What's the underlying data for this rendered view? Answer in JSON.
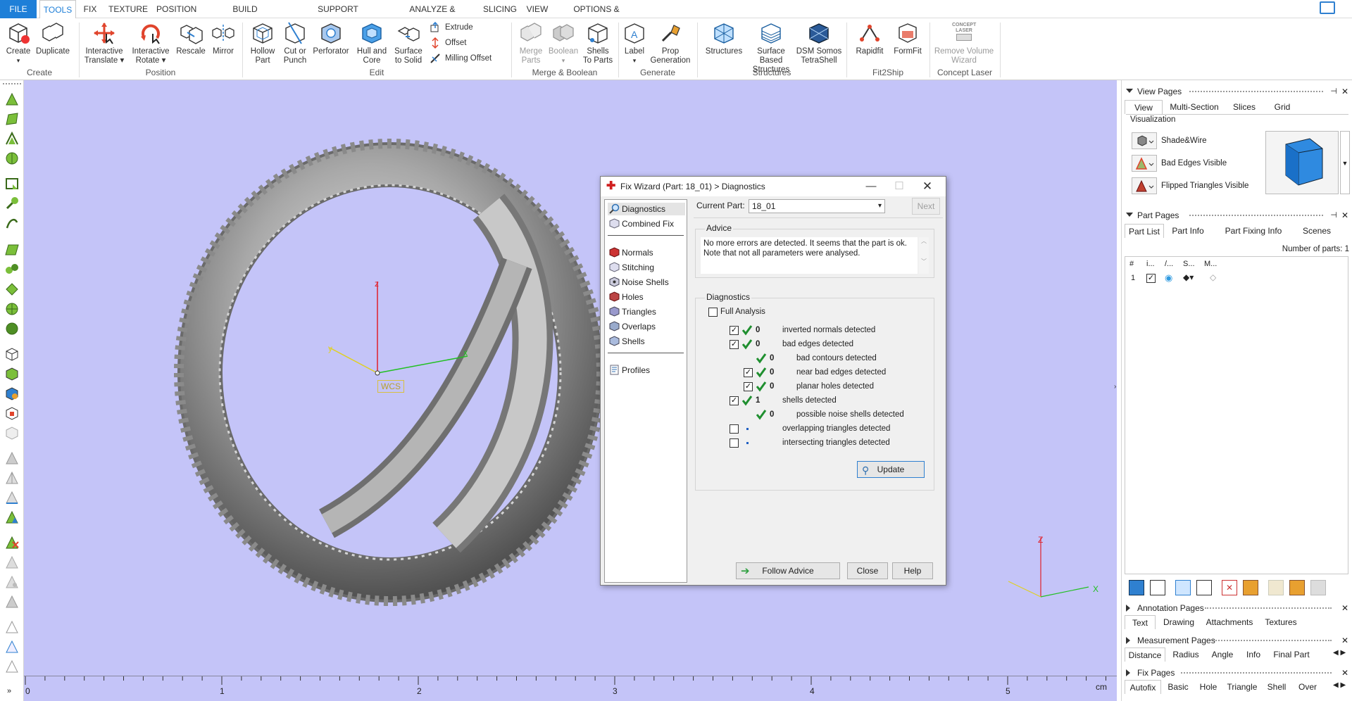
{
  "menu": {
    "tabs": [
      "FILE",
      "TOOLS",
      "FIX",
      "TEXTURE",
      "POSITION",
      "BUILD PREPARATION",
      "SUPPORT GENERATION",
      "ANALYZE & REPORT",
      "SLICING",
      "VIEW",
      "OPTIONS & HELP"
    ],
    "active": "TOOLS"
  },
  "ribbon": {
    "create": {
      "create": "Create",
      "duplicate": "Duplicate",
      "group": "Create"
    },
    "position": {
      "translate1": "Interactive",
      "translate2": "Translate",
      "rotate1": "Interactive",
      "rotate2": "Rotate",
      "rescale": "Rescale",
      "mirror": "Mirror",
      "group": "Position"
    },
    "edit": {
      "hollow1": "Hollow",
      "hollow2": "Part",
      "cut1": "Cut or",
      "cut2": "Punch",
      "perforator": "Perforator",
      "hull1": "Hull and",
      "hull2": "Core",
      "surface1": "Surface",
      "surface2": "to Solid",
      "extrude": "Extrude",
      "offset": "Offset",
      "milling": "Milling Offset",
      "group": "Edit"
    },
    "merge": {
      "merge1": "Merge",
      "merge2": "Parts",
      "boolean": "Boolean",
      "shells1": "Shells",
      "shells2": "To Parts",
      "group": "Merge & Boolean"
    },
    "generate": {
      "label": "Label",
      "prop1": "Prop",
      "prop2": "Generation",
      "group": "Generate"
    },
    "structures": {
      "structures": "Structures",
      "surface1": "Surface Based",
      "surface2": "Structures",
      "dsm1": "DSM Somos",
      "dsm2": "TetraShell",
      "group": "Structures"
    },
    "fit2ship": {
      "rapidfit": "Rapidfit",
      "formfit": "FormFit",
      "group": "Fit2Ship"
    },
    "laser": {
      "icon_text1": "CONCEPT",
      "icon_text2": "LASER",
      "remove1": "Remove Volume",
      "remove2": "Wizard",
      "group": "Concept Laser"
    }
  },
  "viewport": {
    "axis_z": "z",
    "axis_x": "x",
    "axis_y": "y",
    "wcs": "WCS",
    "mini_axis_z": "Z",
    "mini_axis_x": "X",
    "ruler": [
      "0",
      "1",
      "2",
      "3",
      "4",
      "5"
    ],
    "ruler_unit": "cm"
  },
  "dialog": {
    "title": "Fix Wizard (Part: 18_01) > Diagnostics",
    "nav": [
      "Diagnostics",
      "Combined Fix",
      "Normals",
      "Stitching",
      "Noise Shells",
      "Holes",
      "Triangles",
      "Overlaps",
      "Shells",
      "Profiles"
    ],
    "current_part_label": "Current Part:",
    "current_part": "18_01",
    "next": "Next",
    "advice_title": "Advice",
    "advice_text": "No more errors are detected. It seems that the part is ok. Note that not all parameters were analysed.",
    "diagnostics_title": "Diagnostics",
    "full_analysis": "Full Analysis",
    "rows": [
      {
        "count": "0",
        "label": "inverted normals detected"
      },
      {
        "count": "0",
        "label": "bad edges detected"
      },
      {
        "count": "0",
        "label": "bad contours detected"
      },
      {
        "count": "0",
        "label": "near bad edges detected"
      },
      {
        "count": "0",
        "label": "planar holes detected"
      },
      {
        "count": "1",
        "label": "shells detected"
      },
      {
        "count": "0",
        "label": "possible noise shells detected"
      },
      {
        "count": "",
        "label": "overlapping triangles detected"
      },
      {
        "count": "",
        "label": "intersecting triangles detected"
      }
    ],
    "update": "Update",
    "follow_advice": "Follow Advice",
    "close": "Close",
    "help": "Help"
  },
  "panel": {
    "view_pages": "View Pages",
    "view_tabs": [
      "View",
      "Multi-Section",
      "Slices",
      "Grid"
    ],
    "visualization": "Visualization",
    "vis_items": [
      "Shade&Wire",
      "Bad Edges Visible",
      "Flipped Triangles Visible"
    ],
    "part_pages": "Part Pages",
    "part_tabs": [
      "Part List",
      "Part Info",
      "Part Fixing Info",
      "Scenes"
    ],
    "num_parts": "Number of parts: 1",
    "col_headers": [
      "#",
      "i...",
      "/...",
      "S...",
      "M..."
    ],
    "row_index": "1",
    "annotation_pages": "Annotation Pages",
    "annotation_tabs": [
      "Text",
      "Drawing",
      "Attachments",
      "Textures"
    ],
    "measurement_pages": "Measurement Pages",
    "measurement_tabs": [
      "Distance",
      "Radius",
      "Angle",
      "Info",
      "Final Part"
    ],
    "fix_pages": "Fix Pages",
    "fix_tabs": [
      "Autofix",
      "Basic",
      "Hole",
      "Triangle",
      "Shell",
      "Over"
    ]
  },
  "colors": {
    "accent": "#1e7fd8",
    "viewport_bg": "#c4c4f8"
  }
}
